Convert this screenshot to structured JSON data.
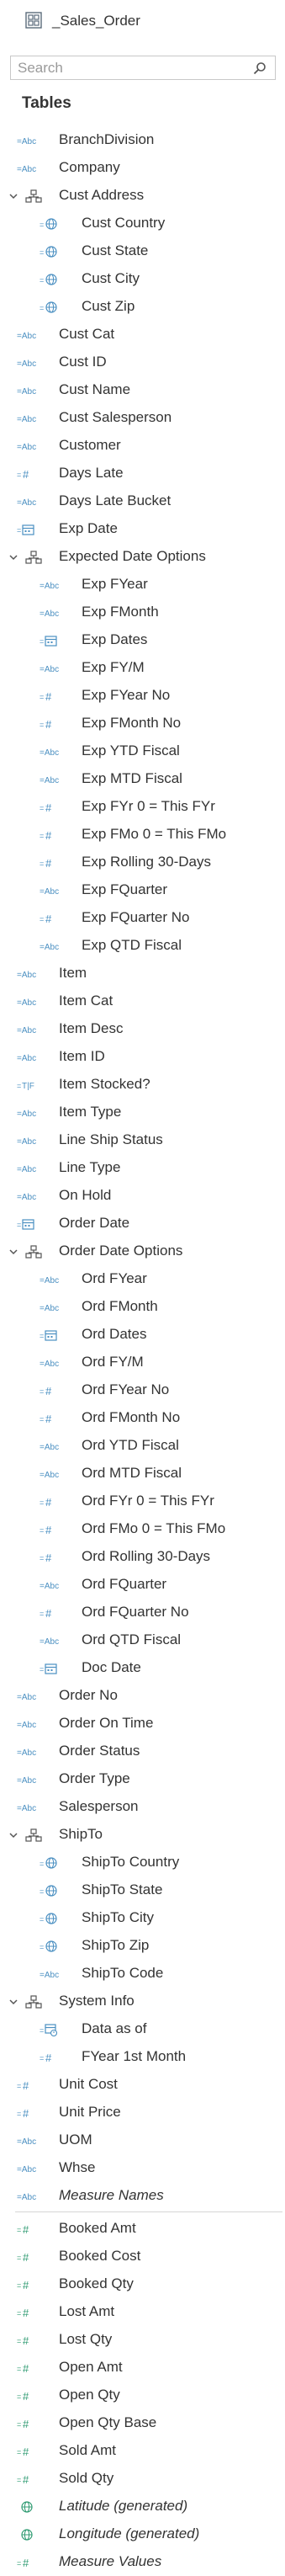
{
  "datasource": {
    "title": "_Sales_Order",
    "icon": "datasource-grid-icon"
  },
  "search": {
    "placeholder": "Search",
    "value": "",
    "icon": "search-icon"
  },
  "tables_header": "Tables",
  "colors": {
    "dimension": "#4a8fc1",
    "measure": "#2f9b72",
    "text": "#333333"
  },
  "dimension_fields": [
    {
      "label": "BranchDivision",
      "type": "abc",
      "level": 0
    },
    {
      "label": "Company",
      "type": "abc",
      "level": 0
    },
    {
      "label": "Cust Address",
      "type": "hierarchy",
      "level": 0,
      "expanded": true
    },
    {
      "label": "Cust Country",
      "type": "geo",
      "level": 1
    },
    {
      "label": "Cust State",
      "type": "geo",
      "level": 1
    },
    {
      "label": "Cust City",
      "type": "geo",
      "level": 1
    },
    {
      "label": "Cust Zip",
      "type": "geo",
      "level": 1
    },
    {
      "label": "Cust Cat",
      "type": "abc",
      "level": 0
    },
    {
      "label": "Cust ID",
      "type": "abc",
      "level": 0
    },
    {
      "label": "Cust Name",
      "type": "abc",
      "level": 0
    },
    {
      "label": "Cust Salesperson",
      "type": "abc",
      "level": 0
    },
    {
      "label": "Customer",
      "type": "abc",
      "level": 0
    },
    {
      "label": "Days Late",
      "type": "number",
      "level": 0
    },
    {
      "label": "Days Late Bucket",
      "type": "abc",
      "level": 0
    },
    {
      "label": "Exp Date",
      "type": "date",
      "level": 0
    },
    {
      "label": "Expected Date Options",
      "type": "hierarchy",
      "level": 0,
      "expanded": true
    },
    {
      "label": "Exp FYear",
      "type": "abc",
      "level": 1
    },
    {
      "label": "Exp FMonth",
      "type": "abc",
      "level": 1
    },
    {
      "label": "Exp Dates",
      "type": "date",
      "level": 1
    },
    {
      "label": "Exp FY/M",
      "type": "abc",
      "level": 1
    },
    {
      "label": "Exp FYear No",
      "type": "number",
      "level": 1
    },
    {
      "label": "Exp FMonth No",
      "type": "number",
      "level": 1
    },
    {
      "label": "Exp YTD Fiscal",
      "type": "abc",
      "level": 1
    },
    {
      "label": "Exp MTD Fiscal",
      "type": "abc",
      "level": 1
    },
    {
      "label": "Exp FYr 0 = This FYr",
      "type": "number",
      "level": 1
    },
    {
      "label": "Exp FMo 0 = This FMo",
      "type": "number",
      "level": 1
    },
    {
      "label": "Exp Rolling 30-Days",
      "type": "number",
      "level": 1
    },
    {
      "label": "Exp FQuarter",
      "type": "abc",
      "level": 1
    },
    {
      "label": "Exp FQuarter No",
      "type": "number",
      "level": 1
    },
    {
      "label": "Exp QTD Fiscal",
      "type": "abc",
      "level": 1
    },
    {
      "label": "Item",
      "type": "abc",
      "level": 0
    },
    {
      "label": "Item Cat",
      "type": "abc",
      "level": 0
    },
    {
      "label": "Item Desc",
      "type": "abc",
      "level": 0
    },
    {
      "label": "Item ID",
      "type": "abc",
      "level": 0
    },
    {
      "label": "Item Stocked?",
      "type": "bool",
      "level": 0
    },
    {
      "label": "Item Type",
      "type": "abc",
      "level": 0
    },
    {
      "label": "Line Ship Status",
      "type": "abc",
      "level": 0
    },
    {
      "label": "Line Type",
      "type": "abc",
      "level": 0
    },
    {
      "label": "On Hold",
      "type": "abc",
      "level": 0
    },
    {
      "label": "Order Date",
      "type": "date",
      "level": 0
    },
    {
      "label": "Order Date Options",
      "type": "hierarchy",
      "level": 0,
      "expanded": true
    },
    {
      "label": "Ord FYear",
      "type": "abc",
      "level": 1
    },
    {
      "label": "Ord FMonth",
      "type": "abc",
      "level": 1
    },
    {
      "label": "Ord Dates",
      "type": "date",
      "level": 1
    },
    {
      "label": "Ord FY/M",
      "type": "abc",
      "level": 1
    },
    {
      "label": "Ord FYear No",
      "type": "number",
      "level": 1
    },
    {
      "label": "Ord FMonth No",
      "type": "number",
      "level": 1
    },
    {
      "label": "Ord YTD Fiscal",
      "type": "abc",
      "level": 1
    },
    {
      "label": "Ord MTD Fiscal",
      "type": "abc",
      "level": 1
    },
    {
      "label": "Ord FYr 0 = This FYr",
      "type": "number",
      "level": 1
    },
    {
      "label": "Ord FMo 0 = This FMo",
      "type": "number",
      "level": 1
    },
    {
      "label": "Ord Rolling 30-Days",
      "type": "number",
      "level": 1
    },
    {
      "label": "Ord FQuarter",
      "type": "abc",
      "level": 1
    },
    {
      "label": "Ord FQuarter No",
      "type": "number",
      "level": 1
    },
    {
      "label": "Ord QTD Fiscal",
      "type": "abc",
      "level": 1
    },
    {
      "label": "Doc Date",
      "type": "date",
      "level": 1
    },
    {
      "label": "Order No",
      "type": "abc",
      "level": 0
    },
    {
      "label": "Order On Time",
      "type": "abc",
      "level": 0
    },
    {
      "label": "Order Status",
      "type": "abc",
      "level": 0
    },
    {
      "label": "Order Type",
      "type": "abc",
      "level": 0
    },
    {
      "label": "Salesperson",
      "type": "abc",
      "level": 0
    },
    {
      "label": "ShipTo",
      "type": "hierarchy",
      "level": 0,
      "expanded": true
    },
    {
      "label": "ShipTo Country",
      "type": "geo",
      "level": 1
    },
    {
      "label": "ShipTo State",
      "type": "geo",
      "level": 1
    },
    {
      "label": "ShipTo City",
      "type": "geo",
      "level": 1
    },
    {
      "label": "ShipTo Zip",
      "type": "geo",
      "level": 1
    },
    {
      "label": "ShipTo Code",
      "type": "abc",
      "level": 1
    },
    {
      "label": "System Info",
      "type": "hierarchy",
      "level": 0,
      "expanded": true
    },
    {
      "label": "Data as of",
      "type": "datetime",
      "level": 1
    },
    {
      "label": "FYear 1st Month",
      "type": "number",
      "level": 1
    },
    {
      "label": "Unit Cost",
      "type": "number",
      "level": 0
    },
    {
      "label": "Unit Price",
      "type": "number",
      "level": 0
    },
    {
      "label": "UOM",
      "type": "abc",
      "level": 0
    },
    {
      "label": "Whse",
      "type": "abc",
      "level": 0
    },
    {
      "label": "Measure Names",
      "type": "abc",
      "level": 0,
      "italic": true
    }
  ],
  "measure_fields": [
    {
      "label": "Booked Amt",
      "type": "measure-number",
      "level": 0
    },
    {
      "label": "Booked Cost",
      "type": "measure-number",
      "level": 0
    },
    {
      "label": "Booked Qty",
      "type": "measure-number",
      "level": 0
    },
    {
      "label": "Lost Amt",
      "type": "measure-number",
      "level": 0
    },
    {
      "label": "Lost Qty",
      "type": "measure-number",
      "level": 0
    },
    {
      "label": "Open Amt",
      "type": "measure-number",
      "level": 0
    },
    {
      "label": "Open Qty",
      "type": "measure-number",
      "level": 0
    },
    {
      "label": "Open Qty Base",
      "type": "measure-number",
      "level": 0
    },
    {
      "label": "Sold Amt",
      "type": "measure-number",
      "level": 0
    },
    {
      "label": "Sold Qty",
      "type": "measure-number",
      "level": 0
    },
    {
      "label": "Latitude (generated)",
      "type": "measure-geo",
      "level": 0,
      "italic": true
    },
    {
      "label": "Longitude (generated)",
      "type": "measure-geo",
      "level": 0,
      "italic": true
    },
    {
      "label": "Measure Values",
      "type": "measure-number",
      "level": 0,
      "italic": true
    }
  ]
}
